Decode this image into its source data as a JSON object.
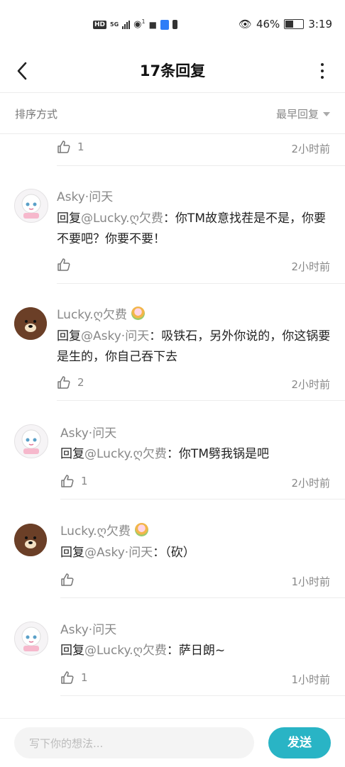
{
  "status_bar": {
    "network": "HD",
    "signal_label": "5G",
    "hotspot_count": "1",
    "battery_percent": "46%",
    "time": "3:19"
  },
  "header": {
    "title": "17条回复",
    "back_icon": "chevron-left-icon",
    "more_icon": "more-vertical-icon"
  },
  "sort": {
    "label": "排序方式",
    "selected": "最早回复"
  },
  "top_partial_reply": {
    "likes": "1",
    "time": "2小时前"
  },
  "replies": [
    {
      "author": "Asky·问天",
      "prefix": "回复",
      "mention": "@Lucky.ღ欠费",
      "text": "：你TM故意找茬是不是，你要不要吧？你要不要！",
      "likes": "",
      "time": "2小时前"
    },
    {
      "author": "Lucky.ღ欠费",
      "prefix": "回复",
      "mention": "@Asky·问天",
      "text": "：吸铁石，另外你说的，你这锅要是生的，你自己吞下去",
      "likes": "2",
      "time": "2小时前"
    },
    {
      "author": "Asky·问天",
      "prefix": "回复",
      "mention": "@Lucky.ღ欠费",
      "text": "：你TM劈我锅是吧",
      "likes": "1",
      "time": "2小时前"
    },
    {
      "author": "Lucky.ღ欠费",
      "prefix": "回复",
      "mention": "@Asky·问天",
      "text": "：（砍）",
      "likes": "",
      "time": "1小时前"
    },
    {
      "author": "Asky·问天",
      "prefix": "回复",
      "mention": "@Lucky.ღ欠费",
      "text": "：萨日朗~",
      "likes": "1",
      "time": "1小时前"
    }
  ],
  "composer": {
    "placeholder": "写下你的想法...",
    "send_label": "发送"
  }
}
